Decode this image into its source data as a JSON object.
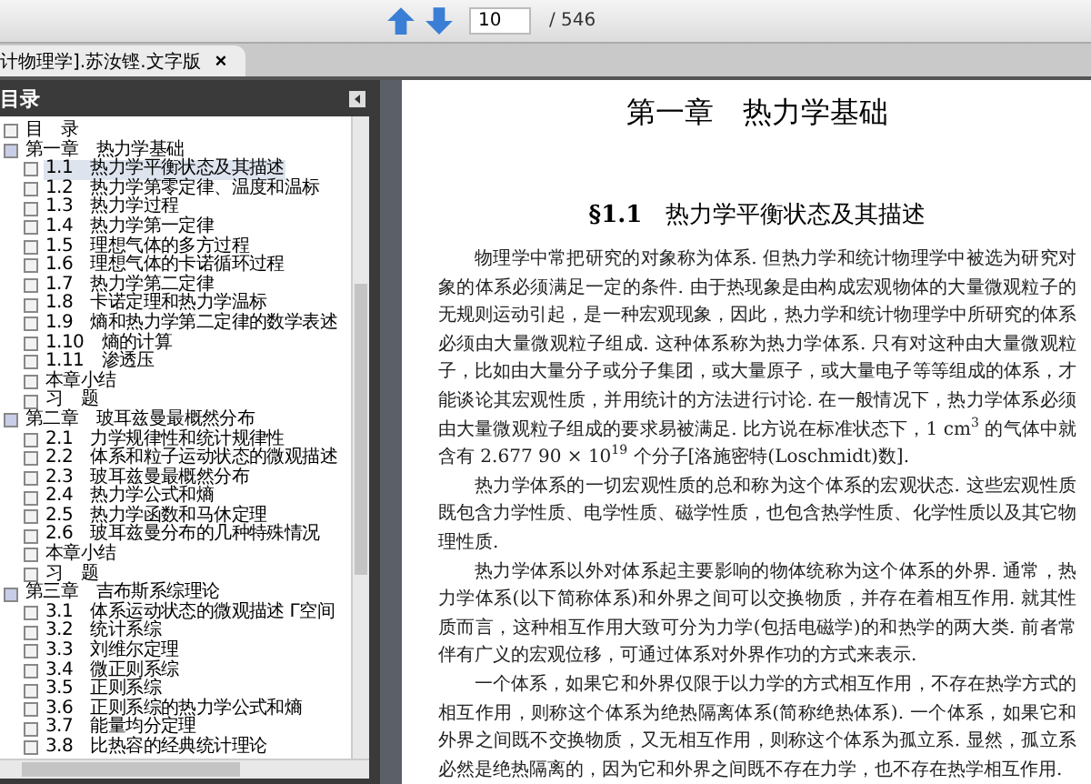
{
  "toolbar": {
    "page_field": "10",
    "page_total": "/ 546"
  },
  "tab": {
    "title": "计物理学].苏汝铿.文字版",
    "close": "×"
  },
  "sidebar": {
    "title": "目录",
    "items": [
      {
        "label": "目　录",
        "selected": false
      },
      {
        "label": "第一章　热力学基础",
        "selected": false,
        "expanded": true,
        "children": [
          {
            "label": "1.1　热力学平衡状态及其描述",
            "selected": true
          },
          {
            "label": "1.2　热力学第零定律、温度和温标",
            "selected": false
          },
          {
            "label": "1.3　热力学过程",
            "selected": false
          },
          {
            "label": "1.4　热力学第一定律",
            "selected": false
          },
          {
            "label": "1.5　理想气体的多方过程",
            "selected": false
          },
          {
            "label": "1.6　理想气体的卡诺循环过程",
            "selected": false
          },
          {
            "label": "1.7　热力学第二定律",
            "selected": false
          },
          {
            "label": "1.8　卡诺定理和热力学温标",
            "selected": false
          },
          {
            "label": "1.9　熵和热力学第二定律的数学表述",
            "selected": false
          },
          {
            "label": "1.10　熵的计算",
            "selected": false
          },
          {
            "label": "1.11　渗透压",
            "selected": false
          },
          {
            "label": "本章小结",
            "selected": false
          },
          {
            "label": "习　题",
            "selected": false
          }
        ]
      },
      {
        "label": "第二章　玻耳兹曼最概然分布",
        "selected": false,
        "expanded": true,
        "children": [
          {
            "label": "2.1　力学规律性和统计规律性",
            "selected": false
          },
          {
            "label": "2.2　体系和粒子运动状态的微观描述",
            "selected": false
          },
          {
            "label": "2.3　玻耳兹曼最概然分布",
            "selected": false
          },
          {
            "label": "2.4　热力学公式和熵",
            "selected": false
          },
          {
            "label": "2.5　热力学函数和马休定理",
            "selected": false
          },
          {
            "label": "2.6　玻耳兹曼分布的几种特殊情况",
            "selected": false
          },
          {
            "label": "本章小结",
            "selected": false
          },
          {
            "label": "习　题",
            "selected": false
          }
        ]
      },
      {
        "label": "第三章　吉布斯系综理论",
        "selected": false,
        "expanded": true,
        "children": [
          {
            "label": "3.1　体系运动状态的微观描述 Γ空间",
            "selected": false
          },
          {
            "label": "3.2　统计系综",
            "selected": false
          },
          {
            "label": "3.3　刘维尔定理",
            "selected": false
          },
          {
            "label": "3.4　微正则系综",
            "selected": false
          },
          {
            "label": "3.5　正则系综",
            "selected": false
          },
          {
            "label": "3.6　正则系综的热力学公式和熵",
            "selected": false
          },
          {
            "label": "3.7　能量均分定理",
            "selected": false
          },
          {
            "label": "3.8　比热容的经典统计理论",
            "selected": false
          }
        ]
      }
    ]
  },
  "page": {
    "chapter_title": "第一章　热力学基础",
    "section_title": "**§1.1**　热力学平衡状态及其描述",
    "paragraphs": [
      "物理学中常把研究的对象称为体系. 但热力学和统计物理学中被选为研究对象的体系必须满足一定的条件. 由于热现象是由构成宏观物体的大量微观粒子的无规则运动引起，是一种宏观现象，因此，热力学和统计物理学中所研究的体系必须由大量微观粒子组成. 这种体系称为热力学体系. 只有对这种由大量微观粒子，比如由大量分子或分子集团，或大量原子，或大量电子等等组成的体系，才能谈论其宏观性质，并用统计的方法进行讨论. 在一般情况下，热力学体系必须由大量微观粒子组成的要求易被满足. 比方说在标准状态下，1 cm$^{3}$ 的气体中就含有 2.677 90 × 10$^{19}$ 个分子[洛施密特(Loschmidt)数].",
      "热力学体系的一切宏观性质的总和称为这个体系的宏观状态. 这些宏观性质既包含力学性质、电学性质、磁学性质，也包含热学性质、化学性质以及其它物理性质.",
      "热力学体系以外对体系起主要影响的物体统称为这个体系的外界. 通常，热力学体系(以下简称体系)和外界之间可以交换物质，并存在着相互作用. 就其性质而言，这种相互作用大致可分为力学(包括电磁学)的和热学的两大类. 前者常伴有广义的宏观位移，可通过体系对外界作功的方式来表示.",
      "一个体系，如果它和外界仅限于以力学的方式相互作用，不存在热学方式的相互作用，则称这个体系为绝热隔离体系(简称绝热体系). 一个体系，如果它和外界之间既不交换物质，又无相互作用，则称这个体系为孤立系. 显然，孤立系必然是绝热隔离的，因为它和外界之间既不存在力学，也不存在热学相互作用."
    ]
  }
}
